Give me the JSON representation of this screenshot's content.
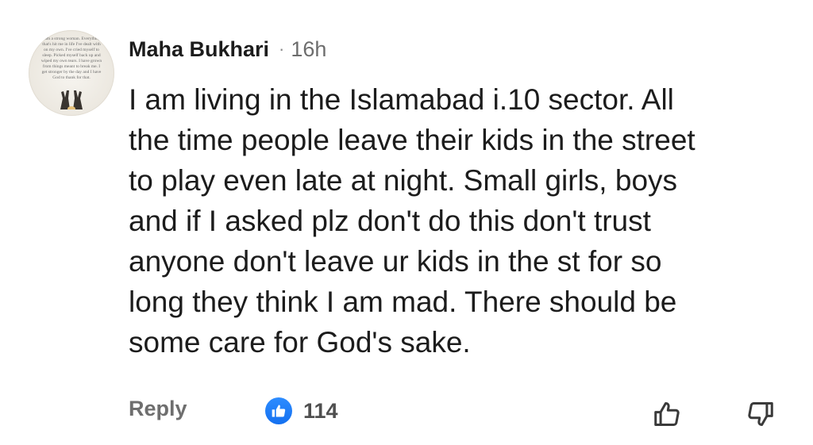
{
  "comment": {
    "avatar": {
      "icon": "profile-photo-quote",
      "text": "I am a strong woman. Everything that's hit me in life I've dealt with on my own. I've cried myself to sleep. Picked myself back up and wiped my own tears. I have grown from things meant to break me. I get stronger by the day and I have God to thank for that."
    },
    "author": "Maha Bukhari",
    "separator": "·",
    "time": "16h",
    "text": "I am living in the Islamabad i.10 sector. All\nthe time people leave their kids in the street\nto play even late at night. Small girls, boys\nand if I asked plz don't do this don't trust\nanyone don't leave ur kids in the st for so\nlong they think I am mad. There should be\nsome care for God's sake."
  },
  "actions": {
    "reply_label": "Reply",
    "reaction_icon": "like-icon",
    "reaction_count": "114",
    "like_icon": "thumbs-up-icon",
    "dislike_icon": "thumbs-down-icon"
  },
  "colors": {
    "text": "#1c1c1c",
    "muted": "#6d6d6d",
    "like_blue": "#1877f2"
  }
}
